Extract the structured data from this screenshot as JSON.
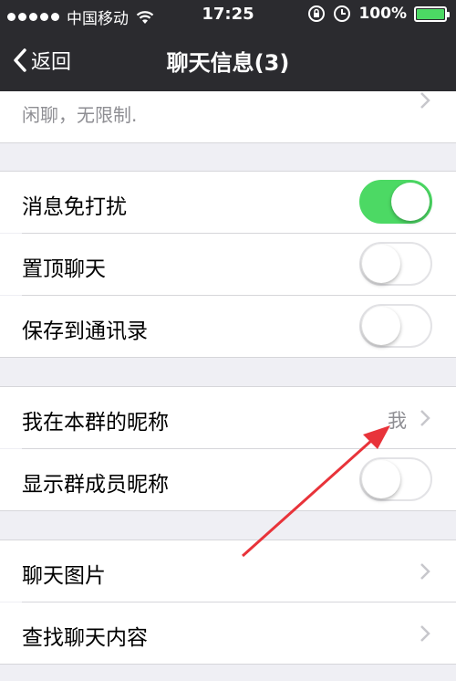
{
  "status_bar": {
    "carrier": "中国移动",
    "time": "17:25",
    "battery": "100%",
    "battery_level": 1.0
  },
  "nav": {
    "back_label": "返回",
    "title": "聊天信息(3)"
  },
  "top_partial": {
    "text": "闲聊，无限制."
  },
  "settings": {
    "mute": {
      "label": "消息免打扰",
      "on": true
    },
    "pin": {
      "label": "置顶聊天",
      "on": false
    },
    "save_contacts": {
      "label": "保存到通讯录",
      "on": false
    },
    "nickname": {
      "label": "我在本群的昵称",
      "value": "我"
    },
    "show_nicknames": {
      "label": "显示群成员昵称",
      "on": false
    },
    "photos": {
      "label": "聊天图片"
    },
    "search": {
      "label": "查找聊天内容"
    }
  },
  "colors": {
    "toggle_on": "#4cd964",
    "navbar": "#2b2b2f",
    "arrow": "#e8333a"
  },
  "icons": [
    "wifi-icon",
    "rotation-lock-icon",
    "alarm-icon",
    "battery-icon",
    "chevron-left-icon",
    "chevron-right-icon"
  ]
}
